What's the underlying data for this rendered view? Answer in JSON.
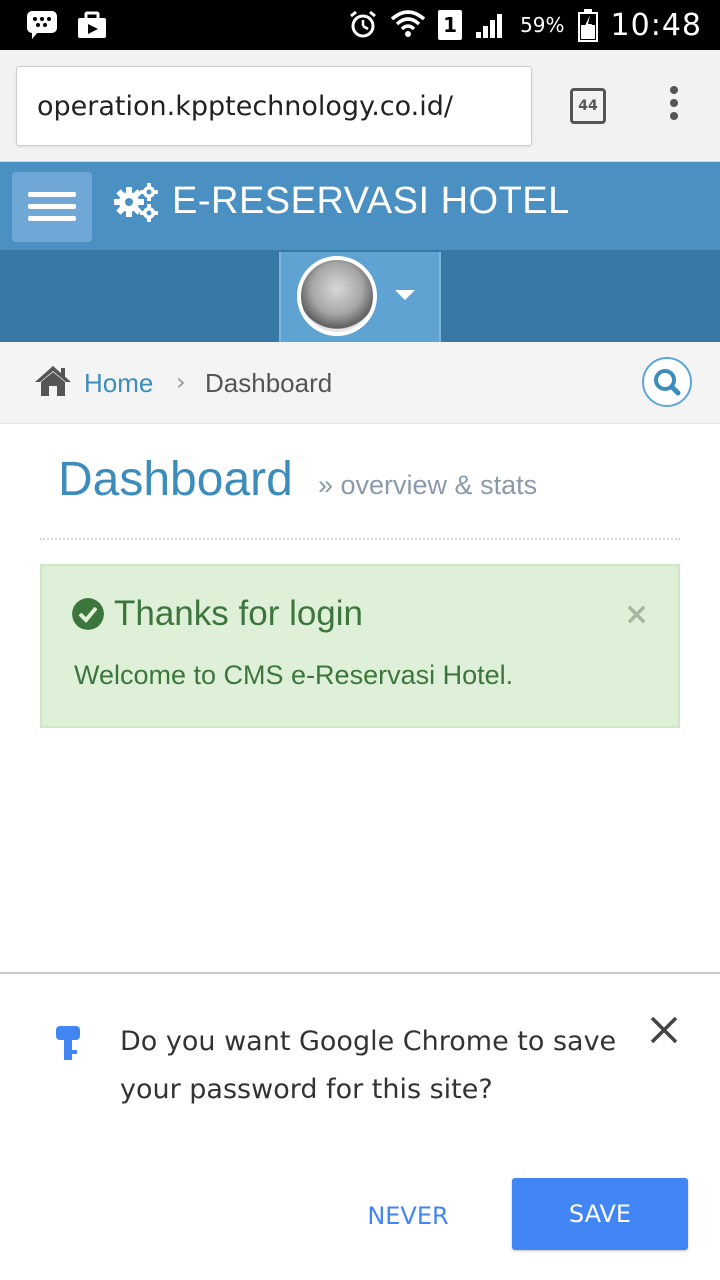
{
  "status_bar": {
    "battery": "59%",
    "time": "10:48",
    "sim": "1",
    "icons": [
      "bbm-icon",
      "briefcase-icon",
      "alarm-icon",
      "wifi-icon",
      "sim-icon",
      "signal-icon",
      "battery-icon"
    ]
  },
  "browser": {
    "url": "operation.kpptechnology.co.id/",
    "tab_count": "44",
    "icons": [
      "tabs-icon",
      "overflow-menu-icon"
    ]
  },
  "app": {
    "brand": "E-RESERVASI HOTEL",
    "icons": [
      "hamburger-icon",
      "gears-icon",
      "avatar",
      "caret-down-icon"
    ]
  },
  "breadcrumb": {
    "home": "Home",
    "separator": "›",
    "current": "Dashboard"
  },
  "page": {
    "title": "Dashboard",
    "subtitle": "» overview & stats"
  },
  "alert": {
    "title": "Thanks for login",
    "message": "Welcome to CMS e-Reservasi Hotel.",
    "close": "×"
  },
  "password_prompt": {
    "text": "Do you want Google Chrome to save your password for this site?",
    "never_label": "NEVER",
    "save_label": "SAVE"
  },
  "colors": {
    "header": "#4a90c2",
    "userbar": "#3878a4",
    "accent": "#3c8dbc",
    "alert_bg": "#dff0d8",
    "alert_text": "#3c763d",
    "chrome_blue": "#4285f4"
  }
}
